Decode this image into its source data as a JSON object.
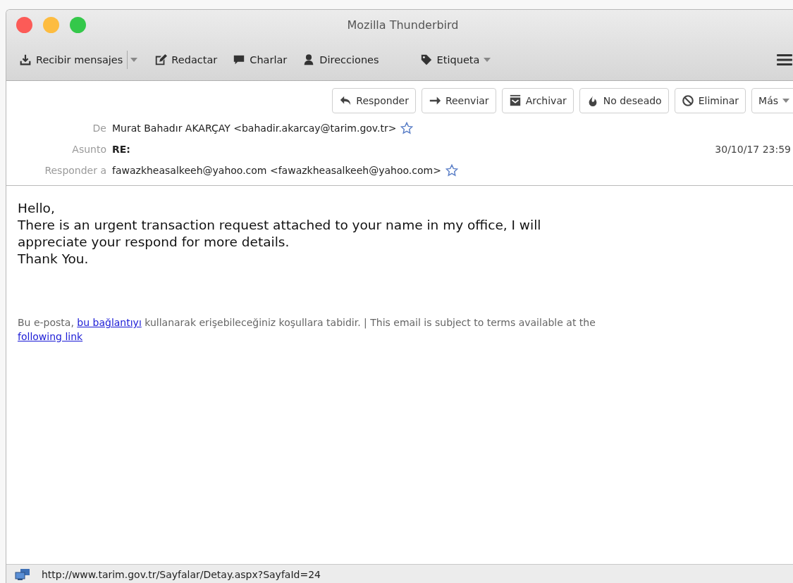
{
  "window": {
    "title": "Mozilla Thunderbird"
  },
  "toolbar": [
    {
      "kind": "download",
      "label": "Recibir mensajes",
      "split": true
    },
    {
      "kind": "compose",
      "label": "Redactar"
    },
    {
      "kind": "chat",
      "label": "Charlar"
    },
    {
      "kind": "contacts",
      "label": "Direcciones"
    },
    {
      "kind": "tag",
      "label": "Etiqueta",
      "dropdown": true
    }
  ],
  "message_actions": [
    {
      "kind": "reply",
      "label": "Responder"
    },
    {
      "kind": "forward",
      "label": "Reenviar"
    },
    {
      "kind": "archive",
      "label": "Archivar"
    },
    {
      "kind": "junk",
      "label": "No deseado"
    },
    {
      "kind": "delete",
      "label": "Eliminar"
    },
    {
      "kind": "more",
      "label": "Más"
    }
  ],
  "headers": [
    {
      "kind": "from",
      "label": "De",
      "value": "Murat Bahadır AKARÇAY <bahadir.akarcay@tarim.gov.tr>",
      "starred": false
    },
    {
      "kind": "subject",
      "label": "Asunto",
      "value": "RE:",
      "date": "30/10/17 23:59"
    },
    {
      "kind": "reply_to",
      "label": "Responder a",
      "value": "fawazkheasalkeeh@yahoo.com <fawazkheasalkeeh@yahoo.com>",
      "starred": false
    }
  ],
  "body": {
    "lines": [
      "Hello,",
      "There is an urgent transaction request attached to your name in my office, I will",
      "appreciate your respond for more details.",
      "Thank You."
    ],
    "footer": {
      "before": "Bu e-posta, ",
      "link1": "bu bağlantıyı",
      "middle": " kullanarak erişebileceğiniz koşullara tabidir. | This email is subject to terms available at the ",
      "link2": "following link"
    }
  },
  "status_bar": {
    "url": "http://www.tarim.gov.tr/Sayfalar/Detay.aspx?SayfaId=24"
  }
}
